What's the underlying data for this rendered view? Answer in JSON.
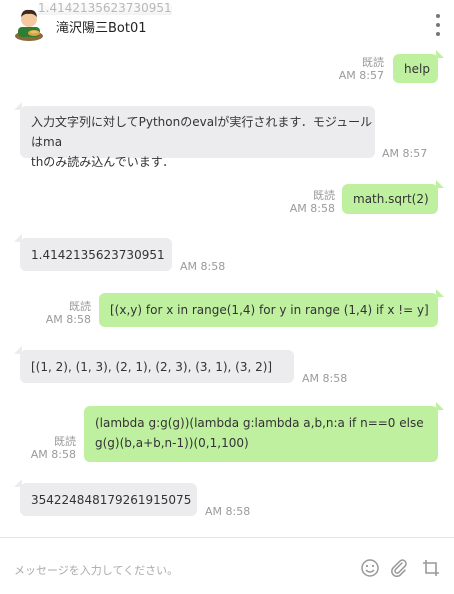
{
  "header": {
    "ghost_text": "1.4142135623730951",
    "title": "滝沢陽三Bot01"
  },
  "messages": [
    {
      "from": "user",
      "text": "help",
      "read_label": "既読",
      "time": "AM 8:57"
    },
    {
      "from": "bot",
      "lines": [
        "入力文字列に対してPythonのevalが実行されます．モジュールはma",
        "thのみ読み込んでいます．"
      ],
      "time": "AM 8:57"
    },
    {
      "from": "user",
      "text": "math.sqrt(2)",
      "read_label": "既読",
      "time": "AM 8:58"
    },
    {
      "from": "bot",
      "text": "1.4142135623730951",
      "time": "AM 8:58"
    },
    {
      "from": "user",
      "text": "[(x,y) for x in range(1,4) for y in range (1,4) if x != y]",
      "read_label": "既読",
      "time": "AM 8:58"
    },
    {
      "from": "bot",
      "text": "[(1, 2), (1, 3), (2, 1), (2, 3), (3, 1), (3, 2)]",
      "time": "AM 8:58"
    },
    {
      "from": "user",
      "lines": [
        "(lambda g:g(g))(lambda g:lambda a,b,n:a if n==0 else",
        "g(g)(b,a+b,n-1))(0,1,100)"
      ],
      "read_label": "既読",
      "time": "AM 8:58"
    },
    {
      "from": "bot",
      "text": "354224848179261915075",
      "time": "AM 8:58"
    }
  ],
  "composer": {
    "placeholder": "メッセージを入力してください。"
  },
  "colors": {
    "user_bubble": "#bff0a0",
    "bot_bubble": "#ececef"
  },
  "icons": [
    "avatar",
    "kebab-menu-icon",
    "emoji-icon",
    "attachment-icon",
    "crop-icon"
  ]
}
